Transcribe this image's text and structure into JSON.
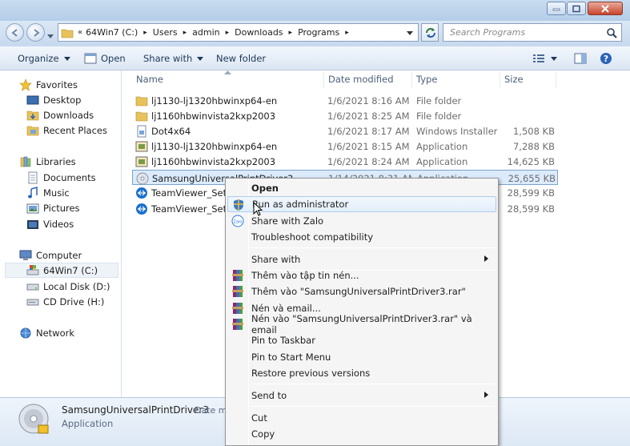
{
  "address": {
    "crumbs": [
      "64Win7 (C:)",
      "Users",
      "admin",
      "Downloads",
      "Programs"
    ],
    "search_placeholder": "Search Programs"
  },
  "toolbar": {
    "organize": "Organize",
    "open": "Open",
    "share_with": "Share with",
    "new_folder": "New folder"
  },
  "nav": {
    "favorites": "Favorites",
    "desktop": "Desktop",
    "downloads": "Downloads",
    "recent": "Recent Places",
    "libraries": "Libraries",
    "documents": "Documents",
    "music": "Music",
    "pictures": "Pictures",
    "videos": "Videos",
    "computer": "Computer",
    "drive_c": "64Win7  (C:)",
    "drive_d": "Local Disk (D:)",
    "drive_h": "CD Drive (H:)",
    "network": "Network"
  },
  "columns": {
    "name": "Name",
    "date": "Date modified",
    "type": "Type",
    "size": "Size"
  },
  "files": [
    {
      "name": "lj1130-lj1320hbwinxp64-en",
      "date": "1/6/2021 8:16 AM",
      "type": "File folder",
      "size": "",
      "icon": "folder-icon"
    },
    {
      "name": "lj1160hbwinvista2kxp2003",
      "date": "1/6/2021 8:25 AM",
      "type": "File folder",
      "size": "",
      "icon": "folder-icon"
    },
    {
      "name": "Dot4x64",
      "date": "1/6/2021 8:17 AM",
      "type": "Windows Installer ...",
      "size": "1,508 KB",
      "icon": "installer-icon"
    },
    {
      "name": "lj1130-lj1320hbwinxp64-en",
      "date": "1/6/2021 8:15 AM",
      "type": "Application",
      "size": "7,288 KB",
      "icon": "setup-app-icon"
    },
    {
      "name": "lj1160hbwinvista2kxp2003",
      "date": "1/6/2021 8:24 AM",
      "type": "Application",
      "size": "14,625 KB",
      "icon": "setup-app-icon"
    },
    {
      "name": "SamsungUniversalPrintDriver3",
      "date": "1/14/2021 8:31 AM",
      "type": "Application",
      "size": "25,655 KB",
      "icon": "cd-app-icon"
    },
    {
      "name": "TeamViewer_Setup",
      "date": "",
      "type": "",
      "size": "28,599 KB",
      "icon": "teamviewer-icon"
    },
    {
      "name": "TeamViewer_Setup",
      "date": "",
      "type": "",
      "size": "28,599 KB",
      "icon": "teamviewer-icon"
    }
  ],
  "details": {
    "name": "SamsungUniversalPrintDriver3",
    "date_label": "Date mo",
    "type": "Application"
  },
  "context_menu": {
    "items": [
      "Open",
      "Run as administrator",
      "Share with Zalo",
      "Troubleshoot compatibility",
      "Share with",
      "Thêm vào tập tin nén...",
      "Thêm vào \"SamsungUniversalPrintDriver3.rar\"",
      "Nén và email...",
      "Nén vào \"SamsungUniversalPrintDriver3.rar\" và email",
      "Pin to Taskbar",
      "Pin to Start Menu",
      "Restore previous versions",
      "Send to",
      "Cut",
      "Copy"
    ]
  }
}
